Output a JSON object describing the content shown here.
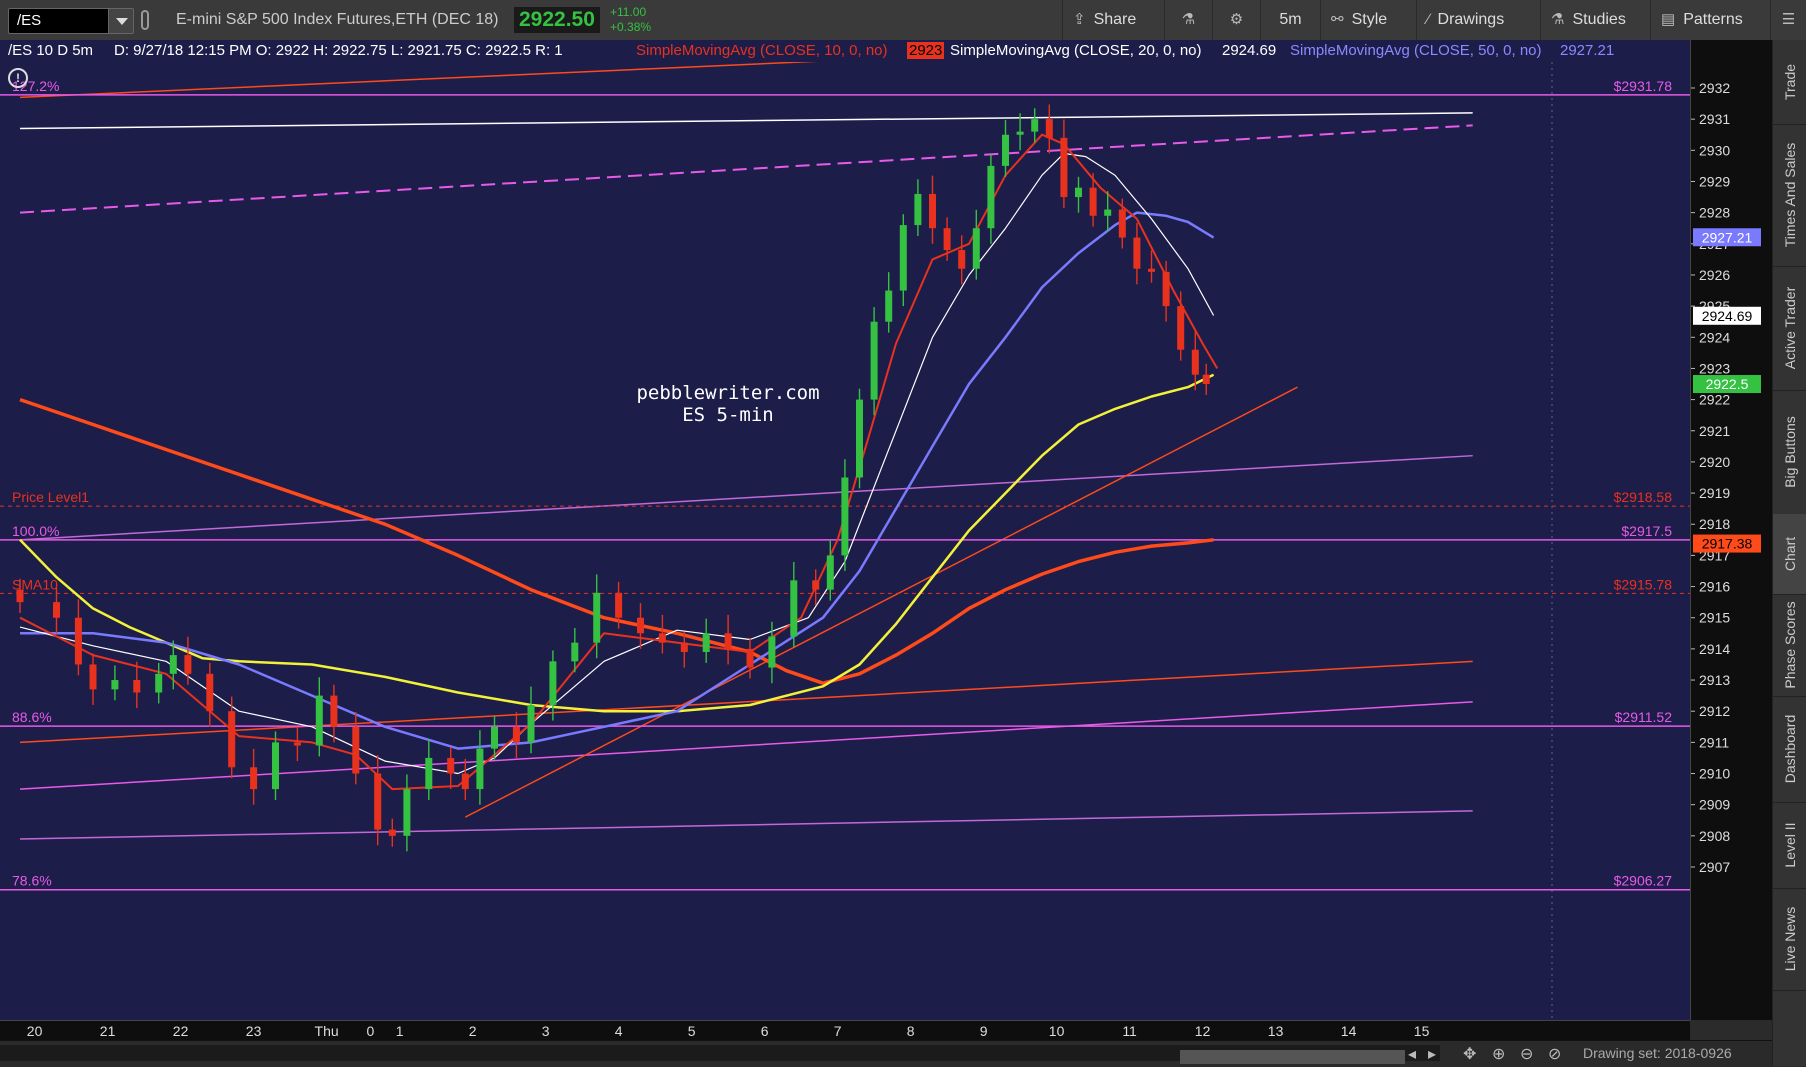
{
  "toolbar": {
    "symbol": "/ES",
    "description": "E-mini S&P 500 Index Futures,ETH (DEC 18)",
    "last_price": "2922.50",
    "net_change": "+11.00",
    "pct_change": "+0.38%",
    "share_label": "Share",
    "timeframe_label": "5m",
    "style_label": "Style",
    "drawings_label": "Drawings",
    "studies_label": "Studies",
    "patterns_label": "Patterns"
  },
  "chart_header": {
    "symbol_period": "/ES 10 D 5m",
    "bar_info": "D: 9/27/18 12:15 PM  O: 2922  H: 2922.75  L: 2921.75  C: 2922.5  R: 1",
    "sma10_label": "SimpleMovingAvg (CLOSE, 10, 0, no)",
    "sma10_value": "2923",
    "sma20_label": "SimpleMovingAvg (CLOSE, 20, 0, no)",
    "sma20_value": "2924.69",
    "sma50_label": "SimpleMovingAvg (CLOSE, 50, 0, no)",
    "sma50_value": "2927.21"
  },
  "watermark": {
    "line1": "pebblewriter.com",
    "line2": "ES 5-min"
  },
  "colors": {
    "background": "#1d1d4a",
    "up_candle": "#35c142",
    "down_candle": "#e8321e",
    "sma10": "#e8321e",
    "sma20": "#ffffff",
    "sma50": "#7a7aff",
    "sma_yellow": "#f2f23a",
    "sma_orange": "#ff4a1a",
    "fib": "#e85ae8"
  },
  "chart_data": {
    "type": "candlestick",
    "ylim": [
      2906.5,
      2933.1
    ],
    "y_ticks": [
      2907,
      2908,
      2909,
      2910,
      2911,
      2912,
      2913,
      2914,
      2915,
      2916,
      2917,
      2918,
      2919,
      2920,
      2921,
      2922,
      2923,
      2924,
      2925,
      2926,
      2927,
      2928,
      2929,
      2930,
      2931,
      2932
    ],
    "x_ticks": [
      {
        "label": "20",
        "x": 0.2
      },
      {
        "label": "21",
        "x": 1.2
      },
      {
        "label": "22",
        "x": 2.2
      },
      {
        "label": "23",
        "x": 3.2
      },
      {
        "label": "Thu",
        "x": 4.2
      },
      {
        "label": "0",
        "x": 4.8
      },
      {
        "label": "1",
        "x": 5.2
      },
      {
        "label": "2",
        "x": 6.2
      },
      {
        "label": "3",
        "x": 7.2
      },
      {
        "label": "4",
        "x": 8.2
      },
      {
        "label": "5",
        "x": 9.2
      },
      {
        "label": "6",
        "x": 10.2
      },
      {
        "label": "7",
        "x": 11.2
      },
      {
        "label": "8",
        "x": 12.2
      },
      {
        "label": "9",
        "x": 13.2
      },
      {
        "label": "10",
        "x": 14.2
      },
      {
        "label": "11",
        "x": 15.2
      },
      {
        "label": "12",
        "x": 16.2
      },
      {
        "label": "13",
        "x": 17.2
      },
      {
        "label": "14",
        "x": 18.2
      },
      {
        "label": "15",
        "x": 19.2
      }
    ],
    "closes": [
      {
        "x": 0.0,
        "y": 2915.5
      },
      {
        "x": 0.5,
        "y": 2915.0
      },
      {
        "x": 0.8,
        "y": 2913.5
      },
      {
        "x": 1.0,
        "y": 2912.7
      },
      {
        "x": 1.3,
        "y": 2913.0
      },
      {
        "x": 1.6,
        "y": 2912.6
      },
      {
        "x": 1.9,
        "y": 2913.2
      },
      {
        "x": 2.1,
        "y": 2913.8
      },
      {
        "x": 2.3,
        "y": 2913.2
      },
      {
        "x": 2.6,
        "y": 2912.0
      },
      {
        "x": 2.9,
        "y": 2910.2
      },
      {
        "x": 3.2,
        "y": 2909.5
      },
      {
        "x": 3.5,
        "y": 2911.0
      },
      {
        "x": 3.8,
        "y": 2910.9
      },
      {
        "x": 4.1,
        "y": 2912.5
      },
      {
        "x": 4.3,
        "y": 2911.5
      },
      {
        "x": 4.6,
        "y": 2910.0
      },
      {
        "x": 4.9,
        "y": 2908.2
      },
      {
        "x": 5.1,
        "y": 2908.0
      },
      {
        "x": 5.3,
        "y": 2909.5
      },
      {
        "x": 5.6,
        "y": 2910.5
      },
      {
        "x": 5.9,
        "y": 2910.0
      },
      {
        "x": 6.1,
        "y": 2909.5
      },
      {
        "x": 6.3,
        "y": 2910.8
      },
      {
        "x": 6.5,
        "y": 2911.5
      },
      {
        "x": 6.8,
        "y": 2911.0
      },
      {
        "x": 7.0,
        "y": 2912.2
      },
      {
        "x": 7.3,
        "y": 2913.6
      },
      {
        "x": 7.6,
        "y": 2914.2
      },
      {
        "x": 7.9,
        "y": 2915.8
      },
      {
        "x": 8.2,
        "y": 2915.0
      },
      {
        "x": 8.5,
        "y": 2914.5
      },
      {
        "x": 8.8,
        "y": 2914.2
      },
      {
        "x": 9.1,
        "y": 2913.9
      },
      {
        "x": 9.4,
        "y": 2914.5
      },
      {
        "x": 9.7,
        "y": 2914.0
      },
      {
        "x": 10.0,
        "y": 2913.4
      },
      {
        "x": 10.3,
        "y": 2914.4
      },
      {
        "x": 10.6,
        "y": 2916.2
      },
      {
        "x": 10.9,
        "y": 2915.9
      },
      {
        "x": 11.1,
        "y": 2917.0
      },
      {
        "x": 11.3,
        "y": 2919.5
      },
      {
        "x": 11.5,
        "y": 2922.0
      },
      {
        "x": 11.7,
        "y": 2924.5
      },
      {
        "x": 11.9,
        "y": 2925.5
      },
      {
        "x": 12.1,
        "y": 2927.6
      },
      {
        "x": 12.3,
        "y": 2928.6
      },
      {
        "x": 12.5,
        "y": 2927.5
      },
      {
        "x": 12.7,
        "y": 2926.8
      },
      {
        "x": 12.9,
        "y": 2926.2
      },
      {
        "x": 13.1,
        "y": 2927.5
      },
      {
        "x": 13.3,
        "y": 2929.5
      },
      {
        "x": 13.5,
        "y": 2930.5
      },
      {
        "x": 13.7,
        "y": 2930.6
      },
      {
        "x": 13.9,
        "y": 2931.0
      },
      {
        "x": 14.1,
        "y": 2930.4
      },
      {
        "x": 14.3,
        "y": 2928.5
      },
      {
        "x": 14.5,
        "y": 2928.8
      },
      {
        "x": 14.7,
        "y": 2927.9
      },
      {
        "x": 14.9,
        "y": 2928.1
      },
      {
        "x": 15.1,
        "y": 2927.2
      },
      {
        "x": 15.3,
        "y": 2926.2
      },
      {
        "x": 15.5,
        "y": 2926.1
      },
      {
        "x": 15.7,
        "y": 2925.0
      },
      {
        "x": 15.9,
        "y": 2923.6
      },
      {
        "x": 16.1,
        "y": 2922.8
      },
      {
        "x": 16.25,
        "y": 2922.5
      }
    ],
    "sma_red": [
      [
        0.0,
        2915.0
      ],
      [
        1.0,
        2913.8
      ],
      [
        2.0,
        2913.2
      ],
      [
        3.0,
        2911.2
      ],
      [
        4.0,
        2911.0
      ],
      [
        4.6,
        2910.6
      ],
      [
        5.1,
        2909.5
      ],
      [
        6.0,
        2909.6
      ],
      [
        7.0,
        2911.6
      ],
      [
        8.0,
        2914.5
      ],
      [
        9.0,
        2914.2
      ],
      [
        10.0,
        2913.9
      ],
      [
        10.7,
        2915.0
      ],
      [
        11.2,
        2917.5
      ],
      [
        11.6,
        2920.6
      ],
      [
        12.0,
        2923.8
      ],
      [
        12.5,
        2926.5
      ],
      [
        13.0,
        2927.0
      ],
      [
        13.5,
        2929.2
      ],
      [
        14.0,
        2930.5
      ],
      [
        14.3,
        2930.2
      ],
      [
        14.8,
        2928.8
      ],
      [
        15.3,
        2927.8
      ],
      [
        15.8,
        2925.5
      ],
      [
        16.2,
        2923.8
      ],
      [
        16.4,
        2923.0
      ]
    ],
    "sma_white": [
      [
        0.0,
        2914.7
      ],
      [
        1.0,
        2914.1
      ],
      [
        2.0,
        2913.6
      ],
      [
        3.0,
        2912.0
      ],
      [
        4.0,
        2911.5
      ],
      [
        5.0,
        2910.4
      ],
      [
        6.0,
        2910.0
      ],
      [
        6.5,
        2910.5
      ],
      [
        7.0,
        2911.6
      ],
      [
        8.0,
        2913.6
      ],
      [
        9.0,
        2914.6
      ],
      [
        10.0,
        2914.3
      ],
      [
        10.8,
        2915.0
      ],
      [
        11.3,
        2916.8
      ],
      [
        12.0,
        2921.0
      ],
      [
        12.5,
        2924.0
      ],
      [
        13.0,
        2926.0
      ],
      [
        13.5,
        2927.5
      ],
      [
        14.0,
        2929.2
      ],
      [
        14.3,
        2929.9
      ],
      [
        14.6,
        2929.8
      ],
      [
        15.0,
        2929.2
      ],
      [
        15.5,
        2927.8
      ],
      [
        16.0,
        2926.2
      ],
      [
        16.35,
        2924.7
      ]
    ],
    "sma_blue": [
      [
        0.0,
        2914.5
      ],
      [
        1.0,
        2914.5
      ],
      [
        2.0,
        2914.2
      ],
      [
        3.0,
        2913.5
      ],
      [
        4.0,
        2912.5
      ],
      [
        5.0,
        2911.5
      ],
      [
        6.0,
        2910.8
      ],
      [
        7.0,
        2911.0
      ],
      [
        8.0,
        2911.5
      ],
      [
        9.0,
        2912.0
      ],
      [
        10.0,
        2913.5
      ],
      [
        11.0,
        2915.0
      ],
      [
        11.5,
        2916.5
      ],
      [
        12.0,
        2918.5
      ],
      [
        12.5,
        2920.5
      ],
      [
        13.0,
        2922.5
      ],
      [
        13.5,
        2924.0
      ],
      [
        14.0,
        2925.6
      ],
      [
        14.5,
        2926.7
      ],
      [
        15.0,
        2927.6
      ],
      [
        15.3,
        2928.0
      ],
      [
        15.7,
        2927.9
      ],
      [
        16.0,
        2927.7
      ],
      [
        16.35,
        2927.2
      ]
    ],
    "sma_yellow": [
      [
        0.0,
        2917.5
      ],
      [
        0.5,
        2916.3
      ],
      [
        1.0,
        2915.3
      ],
      [
        1.5,
        2914.7
      ],
      [
        2.0,
        2914.2
      ],
      [
        2.5,
        2913.7
      ],
      [
        3.0,
        2913.6
      ],
      [
        4.0,
        2913.5
      ],
      [
        5.0,
        2913.1
      ],
      [
        6.0,
        2912.6
      ],
      [
        7.0,
        2912.2
      ],
      [
        8.0,
        2912.0
      ],
      [
        9.0,
        2912.0
      ],
      [
        10.0,
        2912.2
      ],
      [
        11.0,
        2912.8
      ],
      [
        11.5,
        2913.5
      ],
      [
        12.0,
        2914.8
      ],
      [
        12.5,
        2916.3
      ],
      [
        13.0,
        2917.8
      ],
      [
        13.5,
        2919.0
      ],
      [
        14.0,
        2920.2
      ],
      [
        14.5,
        2921.2
      ],
      [
        15.0,
        2921.7
      ],
      [
        15.5,
        2922.1
      ],
      [
        16.0,
        2922.4
      ],
      [
        16.35,
        2922.8
      ]
    ],
    "sma_orange": [
      [
        0.0,
        2922.0
      ],
      [
        1.0,
        2921.2
      ],
      [
        2.0,
        2920.4
      ],
      [
        3.0,
        2919.6
      ],
      [
        4.0,
        2918.8
      ],
      [
        5.0,
        2918.0
      ],
      [
        6.0,
        2917.0
      ],
      [
        7.0,
        2915.9
      ],
      [
        8.0,
        2915.0
      ],
      [
        9.0,
        2914.5
      ],
      [
        10.0,
        2913.9
      ],
      [
        10.5,
        2913.3
      ],
      [
        11.0,
        2912.9
      ],
      [
        11.5,
        2913.2
      ],
      [
        12.0,
        2913.8
      ],
      [
        12.5,
        2914.5
      ],
      [
        13.0,
        2915.3
      ],
      [
        13.5,
        2915.9
      ],
      [
        14.0,
        2916.4
      ],
      [
        14.5,
        2916.8
      ],
      [
        15.0,
        2917.1
      ],
      [
        15.5,
        2917.3
      ],
      [
        16.0,
        2917.4
      ],
      [
        16.35,
        2917.5
      ]
    ],
    "price_levels": [
      {
        "label": "127.2%",
        "price_label": "$2931.78",
        "y": 2931.78,
        "style": "solid"
      },
      {
        "label": "Price Level1",
        "price_label": "$2918.58",
        "y": 2918.58,
        "style": "dashed"
      },
      {
        "label": "100.0%",
        "price_label": "$2917.5",
        "y": 2917.5,
        "style": "solid"
      },
      {
        "label": "SMA10",
        "price_label": "$2915.78",
        "y": 2915.78,
        "style": "dashed"
      },
      {
        "label": "88.6%",
        "price_label": "$2911.52",
        "y": 2911.52,
        "style": "solid"
      },
      {
        "label": "78.6%",
        "price_label": "$2906.27",
        "y": 2906.27,
        "style": "solid"
      }
    ],
    "trendlines": [
      {
        "x1": 0.0,
        "y1": 2930.7,
        "x2": 19.9,
        "y2": 2931.2,
        "color": "#ffffff",
        "dash": false
      },
      {
        "x1": 0.0,
        "y1": 2928.0,
        "x2": 19.9,
        "y2": 2930.8,
        "color": "#e85ae8",
        "dash": true
      },
      {
        "x1": 0.0,
        "y1": 2911.0,
        "x2": 19.9,
        "y2": 2913.6,
        "color": "#ff4a1a",
        "dash": false
      },
      {
        "x1": 0.0,
        "y1": 2909.5,
        "x2": 19.9,
        "y2": 2912.3,
        "color": "#e85ae8",
        "dash": false
      },
      {
        "x1": 0.0,
        "y1": 2917.5,
        "x2": 19.9,
        "y2": 2920.2,
        "color": "#c06ad8",
        "dash": false
      },
      {
        "x1": 0.0,
        "y1": 2907.9,
        "x2": 19.9,
        "y2": 2908.8,
        "color": "#c06ad8",
        "dash": false
      },
      {
        "x1": 0.0,
        "y1": 2931.7,
        "x2": 13.2,
        "y2": 2933.1,
        "color": "#ff4a1a",
        "dash": false
      },
      {
        "x1": 6.1,
        "y1": 2908.6,
        "x2": 17.5,
        "y2": 2922.4,
        "color": "#ff4a1a",
        "dash": false
      }
    ],
    "axis_badges": [
      {
        "text": "2927.21",
        "y": 2927.21,
        "bg": "#7a7aff",
        "fg": "#ffffff"
      },
      {
        "text": "2924.69",
        "y": 2924.69,
        "bg": "#ffffff",
        "fg": "#000000"
      },
      {
        "text": "2922.5",
        "y": 2922.5,
        "bg": "#35c142",
        "fg": "#ffffff"
      },
      {
        "text": "2917.38",
        "y": 2917.38,
        "bg": "#ff4a1a",
        "fg": "#000000"
      }
    ]
  },
  "right_tabs": [
    "Trade",
    "Times And Sales",
    "Active Trader",
    "Big Buttons",
    "Chart",
    "Phase Scores",
    "Dashboard",
    "Level II",
    "Live News"
  ],
  "bottom": {
    "drawing_set": "Drawing set: 2018-0926"
  }
}
